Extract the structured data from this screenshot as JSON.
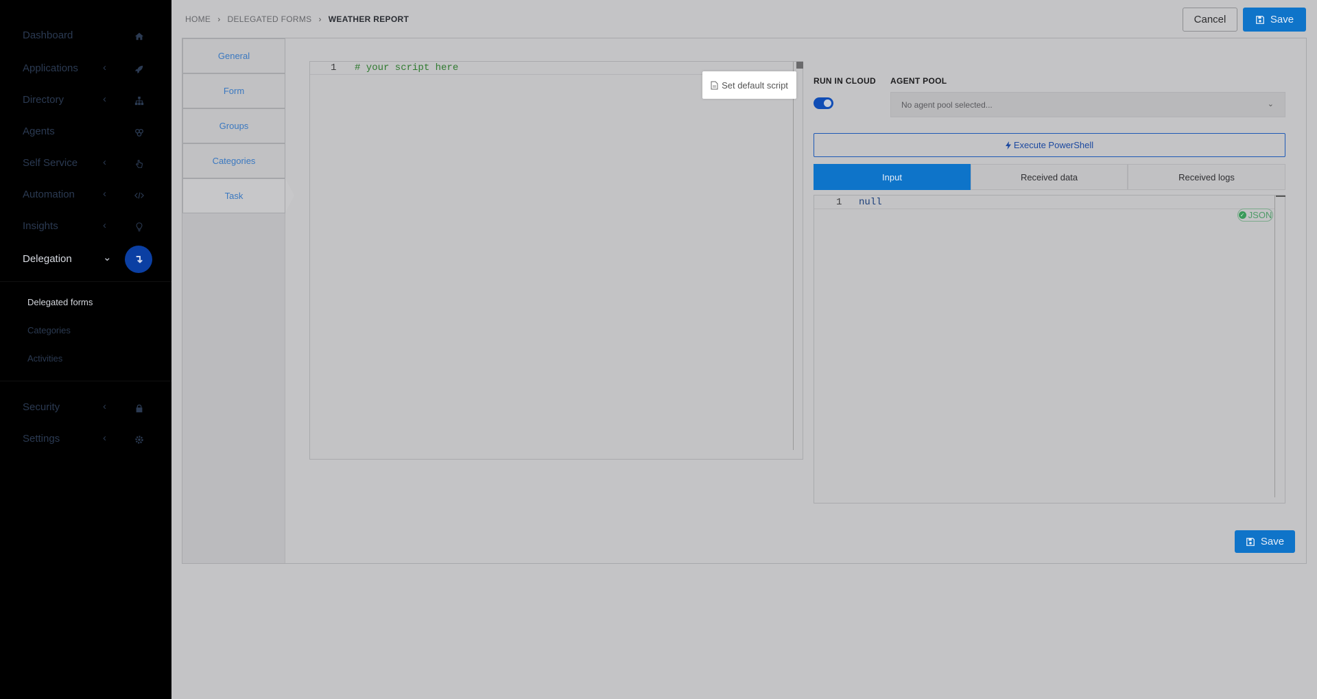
{
  "sidebar": {
    "items": [
      {
        "label": "Dashboard",
        "icon": "home-icon",
        "has_chevron": false
      },
      {
        "label": "Applications",
        "icon": "rocket-icon",
        "has_chevron": true
      },
      {
        "label": "Directory",
        "icon": "sitemap-icon",
        "has_chevron": true
      },
      {
        "label": "Agents",
        "icon": "agents-icon",
        "has_chevron": false
      },
      {
        "label": "Self Service",
        "icon": "hand-pointer-icon",
        "has_chevron": true
      },
      {
        "label": "Automation",
        "icon": "code-icon",
        "has_chevron": true
      },
      {
        "label": "Insights",
        "icon": "lightbulb-icon",
        "has_chevron": true
      },
      {
        "label": "Delegation",
        "icon": "delegation-icon",
        "has_chevron": true,
        "active": true
      },
      {
        "label": "Security",
        "icon": "lock-icon",
        "has_chevron": true
      },
      {
        "label": "Settings",
        "icon": "gear-icon",
        "has_chevron": true
      }
    ],
    "chevron_closed": "‹",
    "chevron_open": "⌄",
    "delegation_icon_glyph": "↴",
    "sub_items": [
      {
        "label": "Delegated forms",
        "active": true
      },
      {
        "label": "Categories",
        "active": false
      },
      {
        "label": "Activities",
        "active": false
      }
    ]
  },
  "breadcrumb": {
    "items": [
      "HOME",
      "DELEGATED FORMS",
      "WEATHER REPORT"
    ],
    "separator": "›"
  },
  "toolbar": {
    "cancel_label": "Cancel",
    "save_label": "Save"
  },
  "form_tabs": [
    {
      "label": "General",
      "active": false
    },
    {
      "label": "Form",
      "active": false
    },
    {
      "label": "Groups",
      "active": false
    },
    {
      "label": "Categories",
      "active": false
    },
    {
      "label": "Task",
      "active": true
    }
  ],
  "script_editor": {
    "line_number": "1",
    "code": "# your script here",
    "default_script_label": "Set default script"
  },
  "run_in_cloud": {
    "label": "RUN IN CLOUD",
    "enabled": true
  },
  "agent_pool": {
    "label": "AGENT POOL",
    "placeholder": "No agent pool selected...",
    "chevron": "⌄"
  },
  "execute_button": {
    "icon": "bolt-icon",
    "label": "Execute PowerShell"
  },
  "result_tabs": [
    {
      "label": "Input",
      "active": true
    },
    {
      "label": "Received data",
      "active": false
    },
    {
      "label": "Received logs",
      "active": false
    }
  ],
  "json_editor": {
    "line_number": "1",
    "code": "null",
    "badge_label": "JSON",
    "badge_check": "✓"
  },
  "bottom_save_label": "Save",
  "colors": {
    "primary": "#0f74c9",
    "sidebar_bg": "#000000",
    "code_comment": "#2f7a2f",
    "code_literal": "#1c3f7a"
  }
}
